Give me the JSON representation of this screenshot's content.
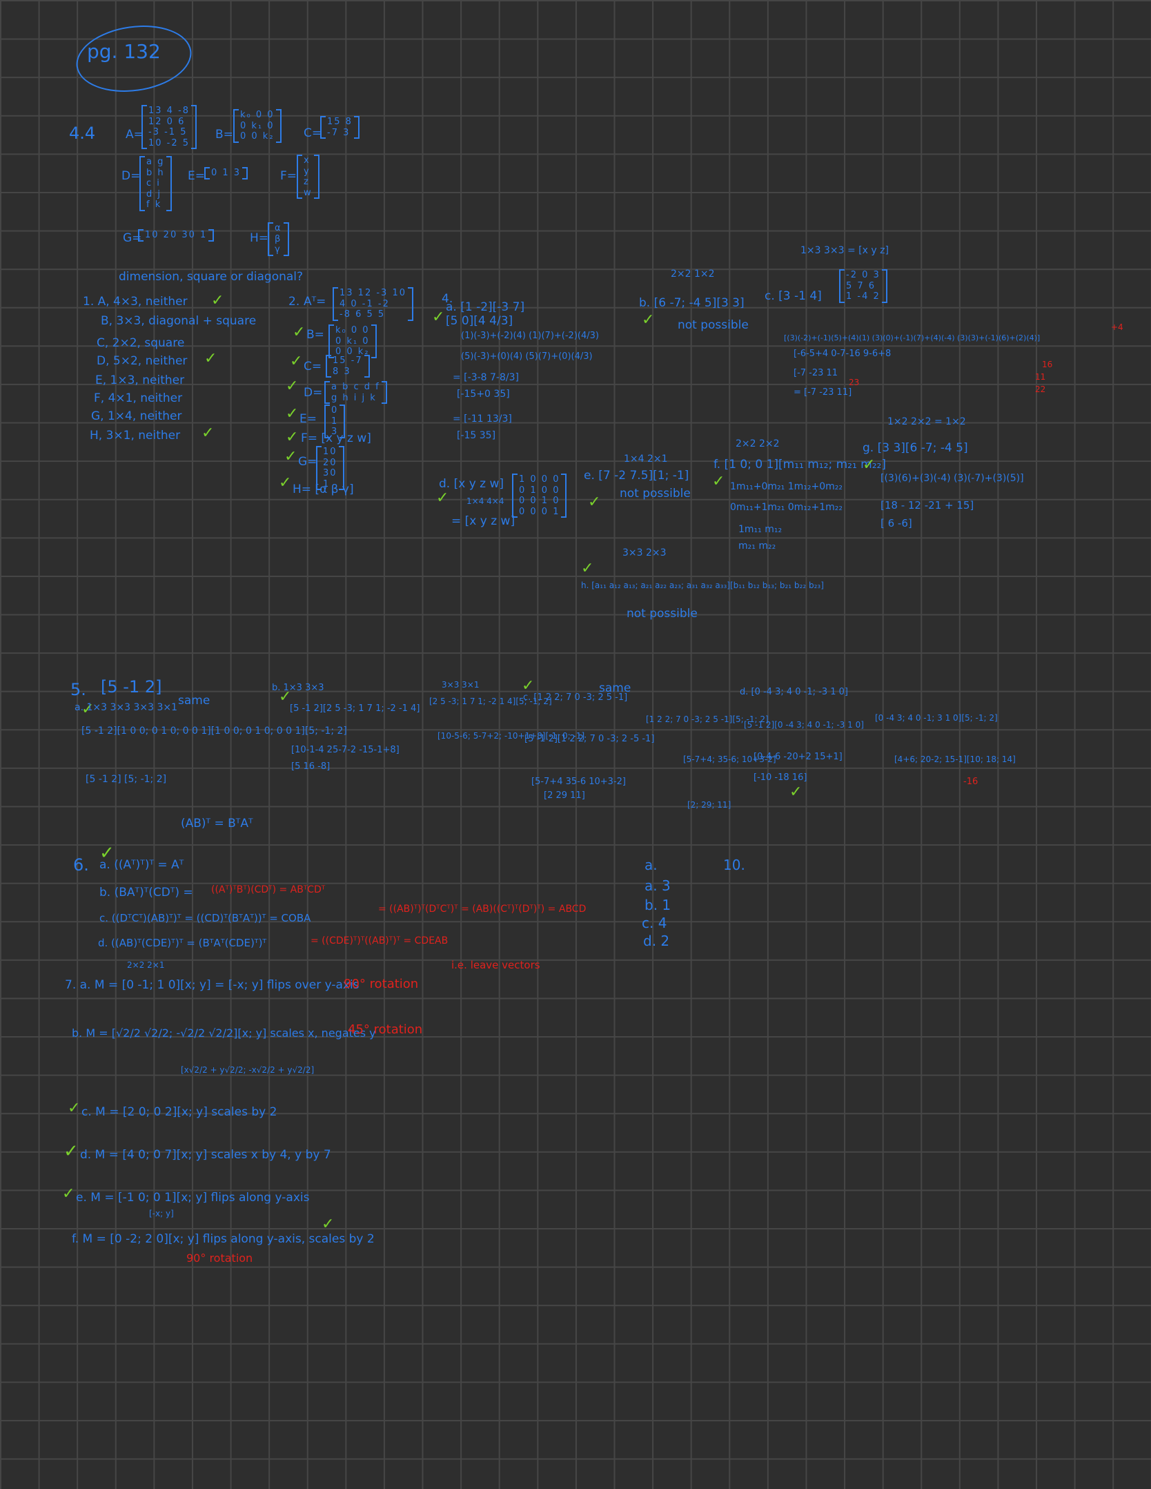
{
  "page": {
    "label": "pg. 132"
  },
  "p44": {
    "title": "4.4",
    "A": {
      "label": "A=",
      "rows": [
        "13  4  -8",
        "12  0   6",
        "-3  -1  5",
        "10  -2  5"
      ]
    },
    "B": {
      "label": "B=",
      "rows": [
        "k₀  0   0",
        "0  k₁  0",
        "0   0  k₂"
      ]
    },
    "C": {
      "label": "C=",
      "rows": [
        "15   8",
        "-7   3"
      ]
    },
    "D": {
      "label": "D=",
      "rows": [
        "a  g",
        "b  h",
        "c  i",
        "d  j",
        "f  k"
      ]
    },
    "E": {
      "label": "E=",
      "rows": [
        "0   1   3"
      ]
    },
    "F": {
      "label": "F=",
      "rows": [
        "x",
        "y",
        "z",
        "w"
      ]
    },
    "G": {
      "label": "G=",
      "rows": [
        "10   20   30   1"
      ]
    },
    "H": {
      "label": "H=",
      "rows": [
        "α",
        "β",
        "γ"
      ]
    }
  },
  "q1": {
    "heading": "dimension, square or diagonal?",
    "items": [
      "1.  A, 4×3, neither",
      "B, 3×3, diagonal + square",
      "C, 2×2, square",
      "D, 5×2, neither",
      "E, 1×3, neither",
      "F, 4×1, neither",
      "G, 1×4, neither",
      "H, 3×1, neither"
    ]
  },
  "q2": {
    "label": "2.",
    "At": {
      "label": "Aᵀ=",
      "rows": [
        "13  12  -3  10",
        "4   0  -1  -2",
        "-8  6   5   5"
      ]
    },
    "Bt": {
      "label": "B=",
      "rows": [
        "k₀  0  0",
        "0  k₁  0",
        "0  0  k₂"
      ]
    },
    "Ct": {
      "label": "C=",
      "rows": [
        "15  -7",
        "8   3"
      ]
    },
    "Dt": {
      "label": "D=",
      "rows": [
        "a  b  c  d  f",
        "g  h  i  j  k"
      ]
    },
    "Et": {
      "label": "E=",
      "rows": [
        "0",
        "1",
        "3"
      ]
    },
    "Ft": "F= [x  y  z  w]",
    "Gt": {
      "label": "G=",
      "rows": [
        "10",
        "20",
        "30",
        "1"
      ]
    },
    "Ht": "H= [α  β  γ]"
  },
  "q4": {
    "label": "4.",
    "a_lines": [
      "a.  [1 -2][-3 7]",
      "    [5  0][4 4/3]",
      "(1)(-3)+(-2)(4)   (1)(7)+(-2)(4/3)",
      "(5)(-3)+(0)(4)    (5)(7)+(0)(4/3)",
      "= [-3-8   7-8/3]",
      "  [-15+0   35]",
      "= [-11   13/3]",
      "  [-15   35]"
    ],
    "b": "b.  [6 -7; -4 5][3 3]",
    "b_dims": "2×2   1×2",
    "b_result": "not possible",
    "c_dims": "1×3        3×3           = [x  y  z]",
    "c": "c.  [3  -1  4]",
    "c_matrix": [
      "-2   0   3",
      "5   7   6",
      "1  -4   2"
    ],
    "c_work": "[(3)(-2)+(-1)(5)+(4)(1)   (3)(0)+(-1)(7)+(4)(-4)   (3)(3)+(-1)(6)+(2)(4)]",
    "c_work2": [
      "[-6-5+4          0-7-16          9-6+8",
      "[-7               -23              11",
      "= [-7   -23   11]"
    ],
    "c_red": [
      "+4",
      "23",
      "11",
      "16",
      "22"
    ],
    "d": "d.  [x  y  z  w]",
    "d_dims": "1×4                4×4",
    "d_identity": [
      "1  0  0  0",
      "0  1  0  0",
      "0  0  1  0",
      "0  0  0  1"
    ],
    "d_result": "= [x   y   z   w]",
    "e": "e.  [7  -2  7.5][1; -1]",
    "e_dims": "1×4     2×1",
    "e_result": "not possible",
    "f_dims": "2×2         2×2",
    "f": "f.  [1 0; 0 1][m₁₁ m₁₂; m₂₁ m₂₂]",
    "f_work": [
      "1m₁₁+0m₂₁    1m₁₂+0m₂₂",
      "0m₁₁+1m₂₁    0m₁₂+1m₂₂",
      "1m₁₁        m₁₂",
      "m₂₁         m₂₂"
    ],
    "g_dims": "1×2     2×2  = 1×2",
    "g": "g.  [3  3][6 -7; -4 5]",
    "g_work": [
      "[(3)(6)+(3)(-4)   (3)(-7)+(3)(5)]",
      "[18 - 12       -21 + 15]",
      "[ 6      -6]"
    ],
    "h_dims": "3×3          2×3",
    "h": "h.  [a₁₁ a₁₂ a₁₃; a₂₁ a₂₂ a₂₃; a₃₁ a₃₂ a₃₃][b₁₁ b₁₂ b₁₃; b₂₁ b₂₂ b₂₃]",
    "h_result": "not possible"
  },
  "q5": {
    "label": "5.",
    "vec": "[5  -1  2]",
    "a_lines": [
      "a.  1×3      3×3       3×3      3×1",
      "[5 -1 2][1 0 0; 0 1 0; 0 0 1][1 0 0; 0 1 0; 0 0 1][5; -1; 2]",
      "[5  -1  2]                       [5; -1; 2]"
    ],
    "same": "same",
    "b_lines": [
      "b.      1×3      3×3",
      "[5  -1  2][2 5 -3; 1 7 1; -2 -1 4]",
      "[10-1-4   25-7-2   -15-1+8]",
      "[5   16   -8]"
    ],
    "b2_lines": [
      "3×3   3×1",
      "[2 5 -3; 1 7 1; -2 1 4][5; -1; 2]",
      "[10-5-6; 5-7+2; -10+1+8][-1; 0; -1]"
    ],
    "c_lines": [
      "c.  [1 2 2; 7 0 -3; 2 5 -1]",
      "[5  -1  2][1 2 2; 7 0 -3; 2 -5 -1]",
      "[5-7+4   35-6   10+3-2]",
      "[2    29    11]"
    ],
    "c2_lines": [
      "[1 2 2; 7 0 -3; 2 5 -1][5; -1; 2]",
      "[5-7+4; 35-6; 10+3-2]",
      "[2; 29; 11]"
    ],
    "d_lines": [
      "d.  [0 -4 3; 4 0 -1; -3 1 0]",
      "[5 -1 2][0 -4 3; 4 0 -1; -3 1 0]",
      "[0-4-6   -20+2   15+1]",
      "[-10   -18   16]"
    ],
    "d2_lines": [
      "[0 -4 3; 4 0 -1; 3 1 0][5; -1; 2]",
      "[4+6; 20-2; 15-1][10; 18; 14]"
    ],
    "d_red": "-16",
    "abt": "(AB)ᵀ = BᵀAᵀ"
  },
  "q6": {
    "label": "6.",
    "a": "a.  ((Aᵀ)ᵀ)ᵀ = Aᵀ",
    "b_blue": "b.  (BAᵀ)ᵀ(CDᵀ) =",
    "b_red": "((Aᵀ)ᵀBᵀ)(CDᵀ) = ABᵀCDᵀ",
    "c_blue": "c.  ((DᵀCᵀ)(AB)ᵀ)ᵀ = ((CD)ᵀ(BᵀAᵀ))ᵀ = COBA",
    "c_red": "= ((AB)ᵀ)ᵀ(DᵀCᵀ)ᵀ = (AB)((Cᵀ)ᵀ(Dᵀ)ᵀ) = ABCD",
    "d_blue": "d.  ((AB)ᵀ(CDE)ᵀ)ᵀ = (BᵀAᵀ(CDE)ᵀ)ᵀ",
    "d_red": "= ((CDE)ᵀ)ᵀ((AB)ᵀ)ᵀ = CDEAB",
    "note_red": "i.e. leave vectors"
  },
  "q7": {
    "a_dims": "2×2  2×1",
    "a": "7. a.  M = [0 -1; 1 0][x; y] = [-x; y]  flips over y-axis",
    "a_red": "90° rotation",
    "b": "b.  M = [√2/2  √2/2; -√2/2  √2/2][x; y]   scales x, negates y",
    "b_red": "45° rotation",
    "b_result": "[x√2/2 + y√2/2; -x√2/2 + y√2/2]",
    "c": "c.  M = [2 0; 0 2][x; y]  scales by 2",
    "d": "d.  M = [4 0; 0 7][x; y]  scales x by 4, y by 7",
    "e": "e.  M = [-1 0; 0 1][x; y]  flips along  y-axis",
    "e_sub": "[-x; y]",
    "f": "f.  M = [0 -2; 2 0][x; y]  flips along y-axis, scales by 2",
    "f_red": "90° rotation"
  },
  "q9": {
    "lines": [
      "a.",
      "a. 3",
      "b. 1",
      "c. 4",
      "d. 2"
    ]
  },
  "q10": {
    "label": "10."
  },
  "checks": [
    "✓"
  ],
  "colors": {
    "background": "#2e2e2e",
    "grid": "#464646",
    "ink_blue": "#2d7ce8",
    "ink_red": "#e0221d",
    "ink_green": "#7ad12c"
  }
}
